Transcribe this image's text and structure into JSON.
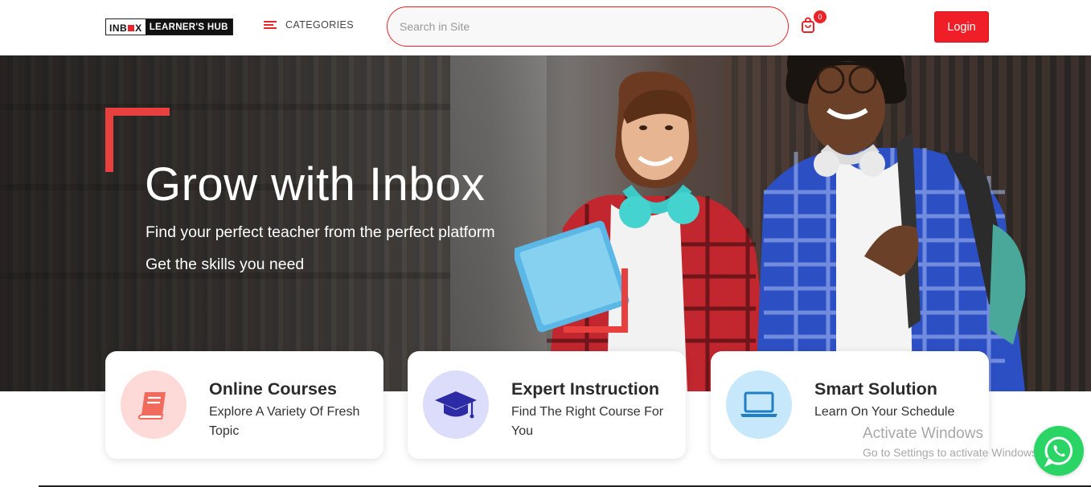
{
  "header": {
    "logo": {
      "left_text_a": "INB",
      "left_text_b": "X",
      "right_text": "LEARNER'S HUB"
    },
    "categories_label": "CATEGORIES",
    "search": {
      "placeholder": "Search in Site",
      "value": ""
    },
    "cart": {
      "count": "0",
      "icon": "shopping-bag-icon"
    },
    "login_label": "Login"
  },
  "hero": {
    "title": "Grow with Inbox",
    "subtitle_1": "Find your perfect teacher from the perfect platform",
    "subtitle_2": "Get the skills you need"
  },
  "features": [
    {
      "title": "Online Courses",
      "description": "Explore A Variety Of Fresh Topic",
      "icon": "book-icon",
      "icon_bg": "#fddad8",
      "icon_color": "#f26a5c"
    },
    {
      "title": "Expert Instruction",
      "description": "Find The Right Course For You",
      "icon": "graduation-cap-icon",
      "icon_bg": "#dcdcfb",
      "icon_color": "#2d2aa6"
    },
    {
      "title": "Smart Solution",
      "description": "Learn On Your Schedule",
      "icon": "laptop-icon",
      "icon_bg": "#c7e7fb",
      "icon_color": "#1f7ec4"
    }
  ],
  "os_watermark": {
    "line_1": "Activate Windows",
    "line_2": "Go to Settings to activate Windows."
  },
  "colors": {
    "accent": "#e8262a",
    "login_bg": "#f01e26",
    "whatsapp": "#2ad566"
  }
}
